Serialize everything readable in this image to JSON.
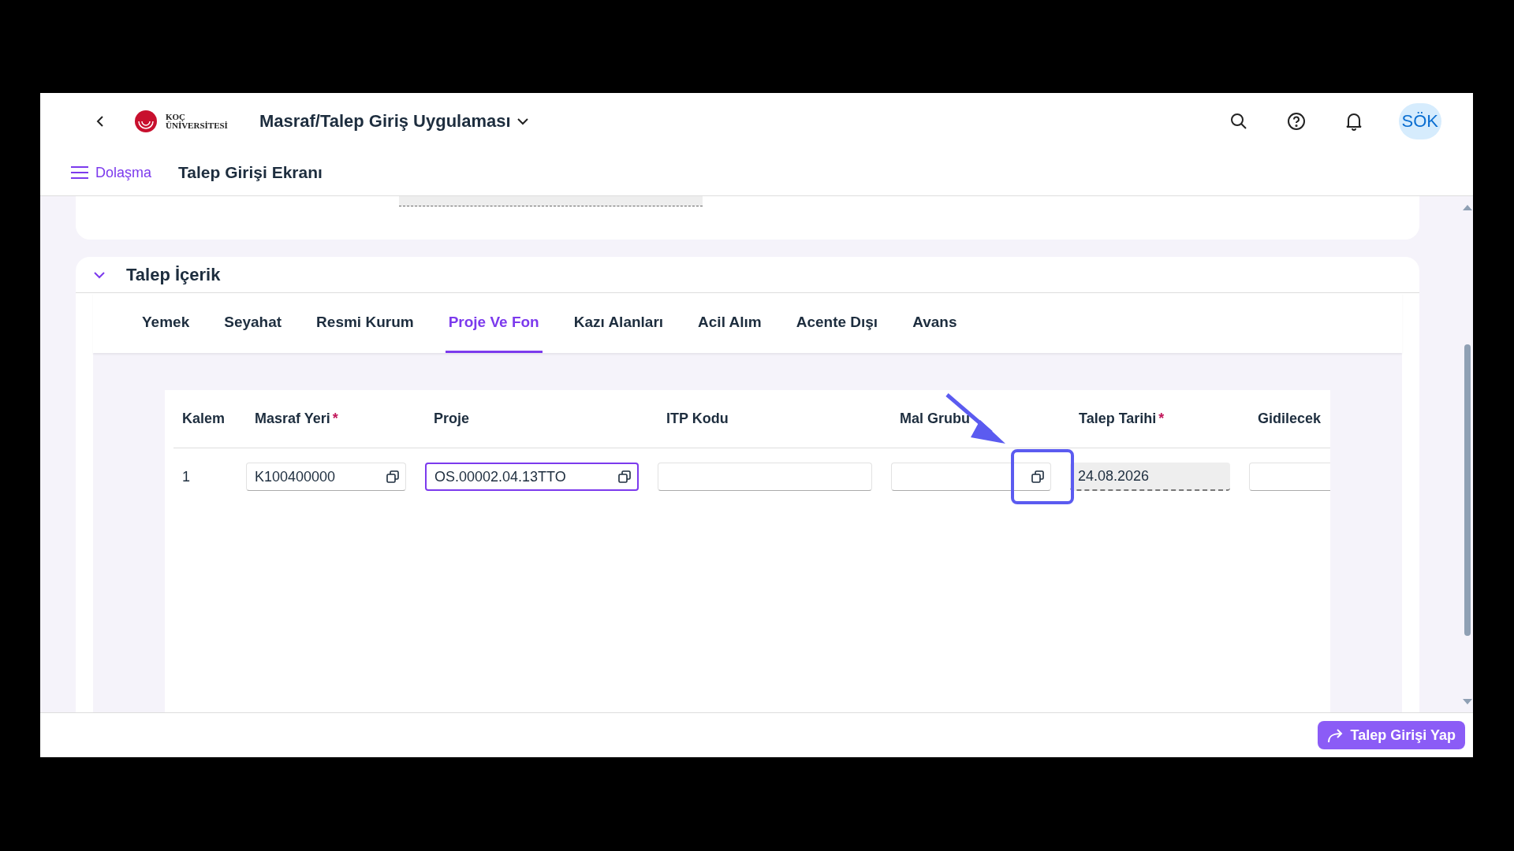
{
  "header": {
    "logo_lines": [
      "KOÇ",
      "ÜNİVERSİTESİ"
    ],
    "app_title": "Masraf/Talep Giriş Uygulaması",
    "avatar": "SÖK"
  },
  "subheader": {
    "nav_label": "Dolaşma",
    "page_title": "Talep Girişi Ekranı"
  },
  "section": {
    "title": "Talep İçerik",
    "expanded": true
  },
  "tabs": [
    {
      "label": "Yemek",
      "selected": false
    },
    {
      "label": "Seyahat",
      "selected": false
    },
    {
      "label": "Resmi Kurum",
      "selected": false
    },
    {
      "label": "Proje Ve Fon",
      "selected": true
    },
    {
      "label": "Kazı Alanları",
      "selected": false
    },
    {
      "label": "Acil Alım",
      "selected": false
    },
    {
      "label": "Acente Dışı",
      "selected": false
    },
    {
      "label": "Avans",
      "selected": false
    }
  ],
  "table": {
    "columns": [
      {
        "label": "Kalem"
      },
      {
        "label": "Masraf Yeri",
        "required_mark": "*"
      },
      {
        "label": "Proje"
      },
      {
        "label": "ITP Kodu"
      },
      {
        "label": "Mal Grubu"
      },
      {
        "label": "Talep Tarihi",
        "required_mark": "*"
      },
      {
        "label": "Gidilecek"
      }
    ],
    "rows": [
      {
        "cells": [
          {
            "kind": "label",
            "value": "1"
          },
          {
            "kind": "value-help",
            "value": "K100400000",
            "focused": false
          },
          {
            "kind": "value-help",
            "value": "OS.00002.04.13TTO",
            "focused": true
          },
          {
            "kind": "text",
            "focused": false
          },
          {
            "kind": "value-help",
            "focused": false
          },
          {
            "kind": "readonly",
            "value": "24.08.2026",
            "focused": false
          },
          {
            "kind": "text",
            "focused": false
          }
        ]
      }
    ]
  },
  "footer": {
    "button": "Talep Girişi Yap"
  }
}
